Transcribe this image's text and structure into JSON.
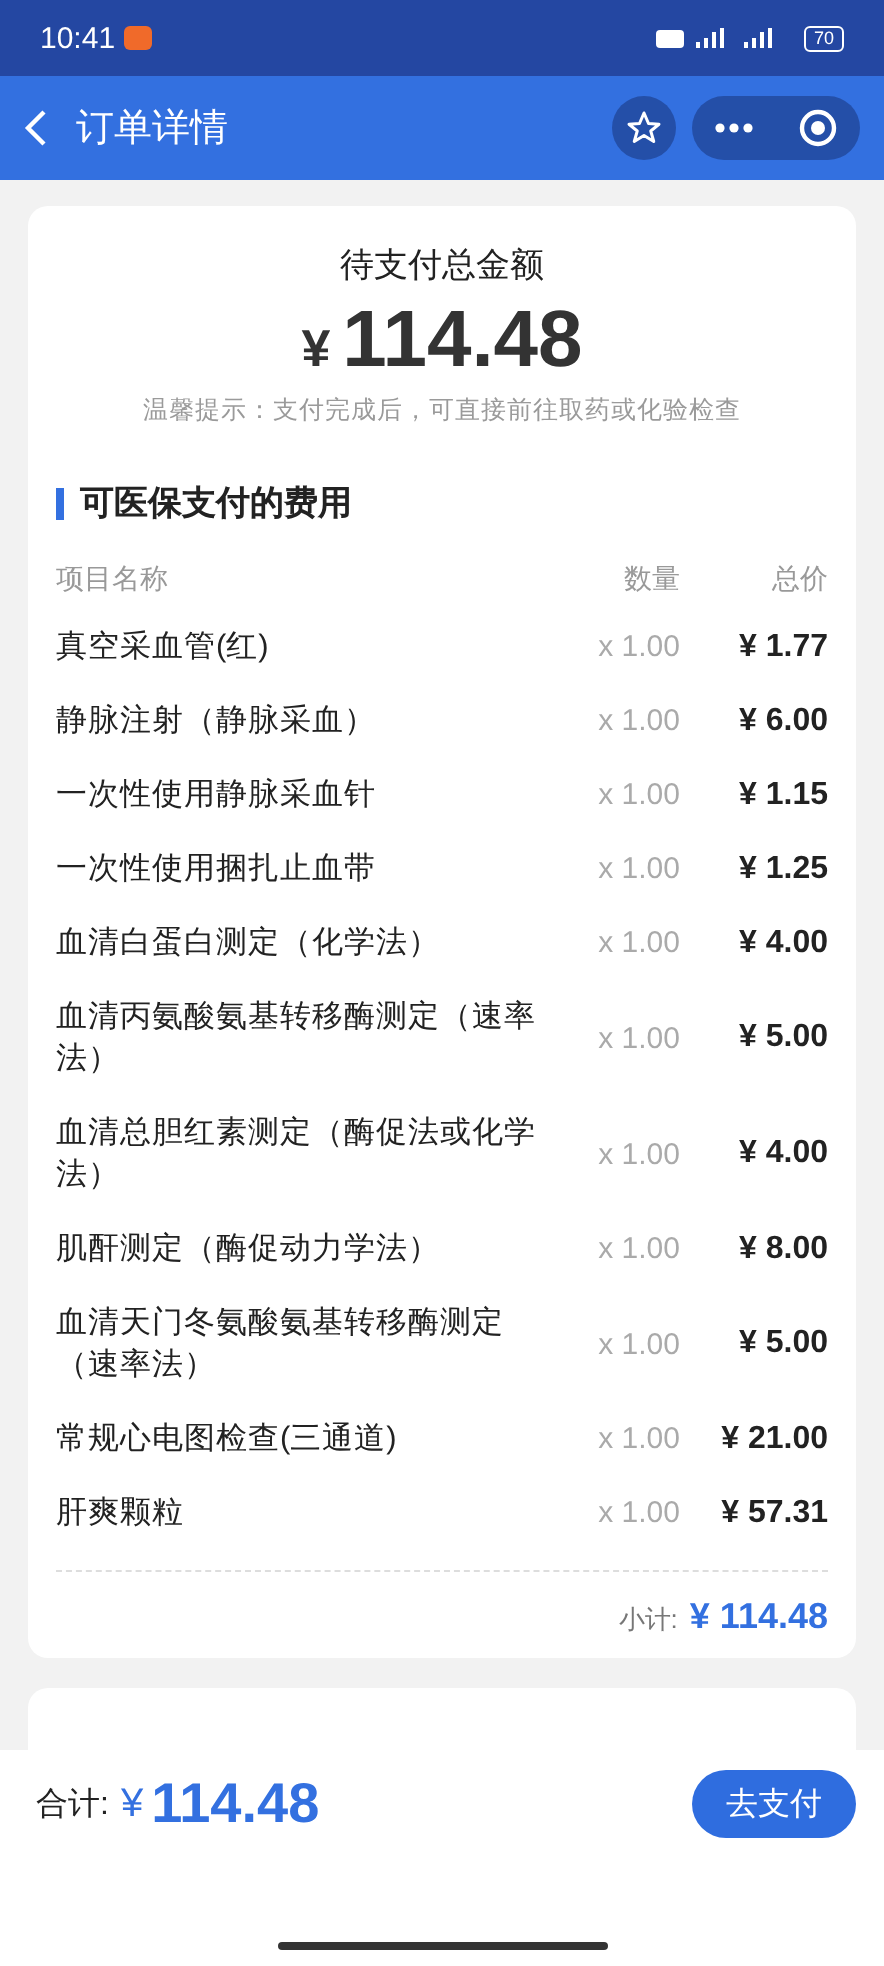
{
  "status_bar": {
    "time": "10:41",
    "battery": "70"
  },
  "nav": {
    "title": "订单详情"
  },
  "summary": {
    "label": "待支付总金额",
    "currency": "¥",
    "amount": "114.48",
    "tip": "温馨提示：支付完成后，可直接前往取药或化验检查"
  },
  "section": {
    "title": "可医保支付的费用",
    "columns": [
      "项目名称",
      "数量",
      "总价"
    ],
    "rows": [
      {
        "name": "真空采血管(红)",
        "qty": "x 1.00",
        "price": "¥ 1.77"
      },
      {
        "name": "静脉注射（静脉采血）",
        "qty": "x 1.00",
        "price": "¥ 6.00"
      },
      {
        "name": "一次性使用静脉采血针",
        "qty": "x 1.00",
        "price": "¥ 1.15"
      },
      {
        "name": "一次性使用捆扎止血带",
        "qty": "x 1.00",
        "price": "¥ 1.25"
      },
      {
        "name": "血清白蛋白测定（化学法）",
        "qty": "x 1.00",
        "price": "¥ 4.00"
      },
      {
        "name": "血清丙氨酸氨基转移酶测定（速率法）",
        "qty": "x 1.00",
        "price": "¥ 5.00"
      },
      {
        "name": "血清总胆红素测定（酶促法或化学法）",
        "qty": "x 1.00",
        "price": "¥ 4.00"
      },
      {
        "name": "肌酐测定（酶促动力学法）",
        "qty": "x 1.00",
        "price": "¥ 8.00"
      },
      {
        "name": "血清天门冬氨酸氨基转移酶测定（速率法）",
        "qty": "x 1.00",
        "price": "¥ 5.00"
      },
      {
        "name": "常规心电图检查(三通道)",
        "qty": "x 1.00",
        "price": "¥ 21.00"
      },
      {
        "name": "肝爽颗粒",
        "qty": "x 1.00",
        "price": "¥ 57.31"
      }
    ],
    "subtotal_label": "小计:",
    "subtotal": "¥ 114.48"
  },
  "footer": {
    "total_label": "合计:",
    "currency": "¥",
    "total": "114.48",
    "pay_button": "去支付"
  }
}
